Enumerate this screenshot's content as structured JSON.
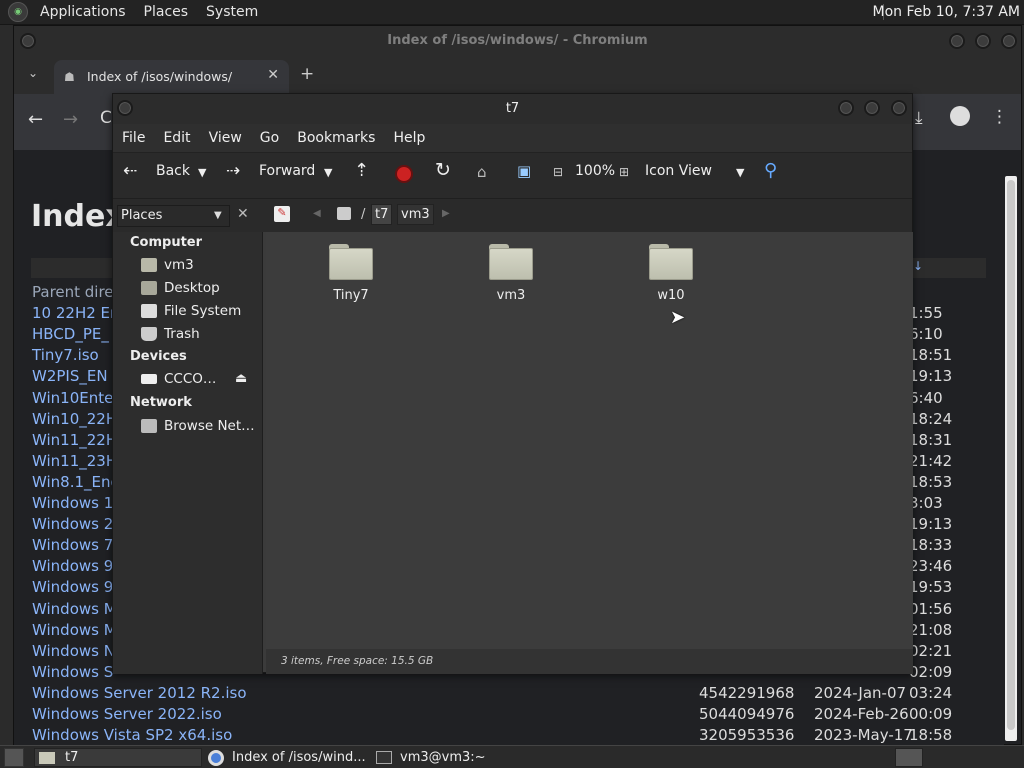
{
  "top_panel": {
    "menus": [
      "Applications",
      "Places",
      "System"
    ],
    "clock": "Mon Feb 10,  7:37 AM"
  },
  "chromium": {
    "window_title": "Index of /isos/windows/ - Chromium",
    "tab_title": "Index of /isos/windows/",
    "new_tab": "+",
    "heading": "Index",
    "files": [
      {
        "name": "Parent dire",
        "size": "",
        "date": "",
        "time": ""
      },
      {
        "name": "10 22H2 En",
        "size": "",
        "date": "",
        "time": "1:55"
      },
      {
        "name": "HBCD_PE_",
        "size": "",
        "date": "",
        "time": "6:10"
      },
      {
        "name": "Tiny7.iso",
        "size": "",
        "date": "",
        "time": "18:51"
      },
      {
        "name": "W2PIS_EN",
        "size": "",
        "date": "",
        "time": "19:13"
      },
      {
        "name": "Win10Ente",
        "size": "",
        "date": "",
        "time": "6:40"
      },
      {
        "name": "Win10_22H",
        "size": "",
        "date": "",
        "time": "18:24"
      },
      {
        "name": "Win11_22H",
        "size": "",
        "date": "",
        "time": "18:31"
      },
      {
        "name": "Win11_23H",
        "size": "",
        "date": "",
        "time": "21:42"
      },
      {
        "name": "Win8.1_Eng",
        "size": "",
        "date": "",
        "time": "18:53"
      },
      {
        "name": "Windows 1",
        "size": "",
        "date": "",
        "time": "3:03"
      },
      {
        "name": "Windows 2",
        "size": "",
        "date": "",
        "time": "19:13"
      },
      {
        "name": "Windows 7",
        "size": "",
        "date": "",
        "time": "18:33"
      },
      {
        "name": "Windows 9",
        "size": "",
        "date": "",
        "time": "23:46"
      },
      {
        "name": "Windows 9",
        "size": "",
        "date": "",
        "time": "19:53"
      },
      {
        "name": "Windows M",
        "size": "",
        "date": "",
        "time": "01:56"
      },
      {
        "name": "Windows M",
        "size": "",
        "date": "",
        "time": "21:08"
      },
      {
        "name": "Windows N",
        "size": "",
        "date": "",
        "time": "02:21"
      },
      {
        "name": "Windows S",
        "size": "",
        "date": "",
        "time": "02:09"
      },
      {
        "name": "Windows Server 2012 R2.iso",
        "size": "4542291968",
        "date": "2024-Jan-07",
        "time": "03:24"
      },
      {
        "name": "Windows Server 2022.iso",
        "size": "5044094976",
        "date": "2024-Feb-26",
        "time": "00:09"
      },
      {
        "name": "Windows Vista SP2 x64.iso",
        "size": "3205953536",
        "date": "2023-May-17",
        "time": "18:58"
      }
    ]
  },
  "nautilus": {
    "window_title": "t7",
    "menu": [
      "File",
      "Edit",
      "View",
      "Go",
      "Bookmarks",
      "Help"
    ],
    "toolbar": {
      "back": "Back",
      "forward": "Forward",
      "zoom": "100%",
      "view_mode": "Icon View"
    },
    "sidebar": {
      "selector": "Places",
      "sections": [
        {
          "title": "Computer",
          "items": [
            "vm3",
            "Desktop",
            "File System",
            "Trash"
          ]
        },
        {
          "title": "Devices",
          "items": [
            "CCCO…"
          ]
        },
        {
          "title": "Network",
          "items": [
            "Browse Net…"
          ]
        }
      ]
    },
    "location": {
      "separator": "/",
      "crumbs": [
        "t7",
        "vm3"
      ]
    },
    "folders": [
      "Tiny7",
      "vm3",
      "w10"
    ],
    "status": "3 items, Free space: 15.5 GB"
  },
  "taskbar": {
    "tasks": [
      "t7",
      "Index of /isos/wind...",
      "vm3@vm3:~"
    ]
  }
}
